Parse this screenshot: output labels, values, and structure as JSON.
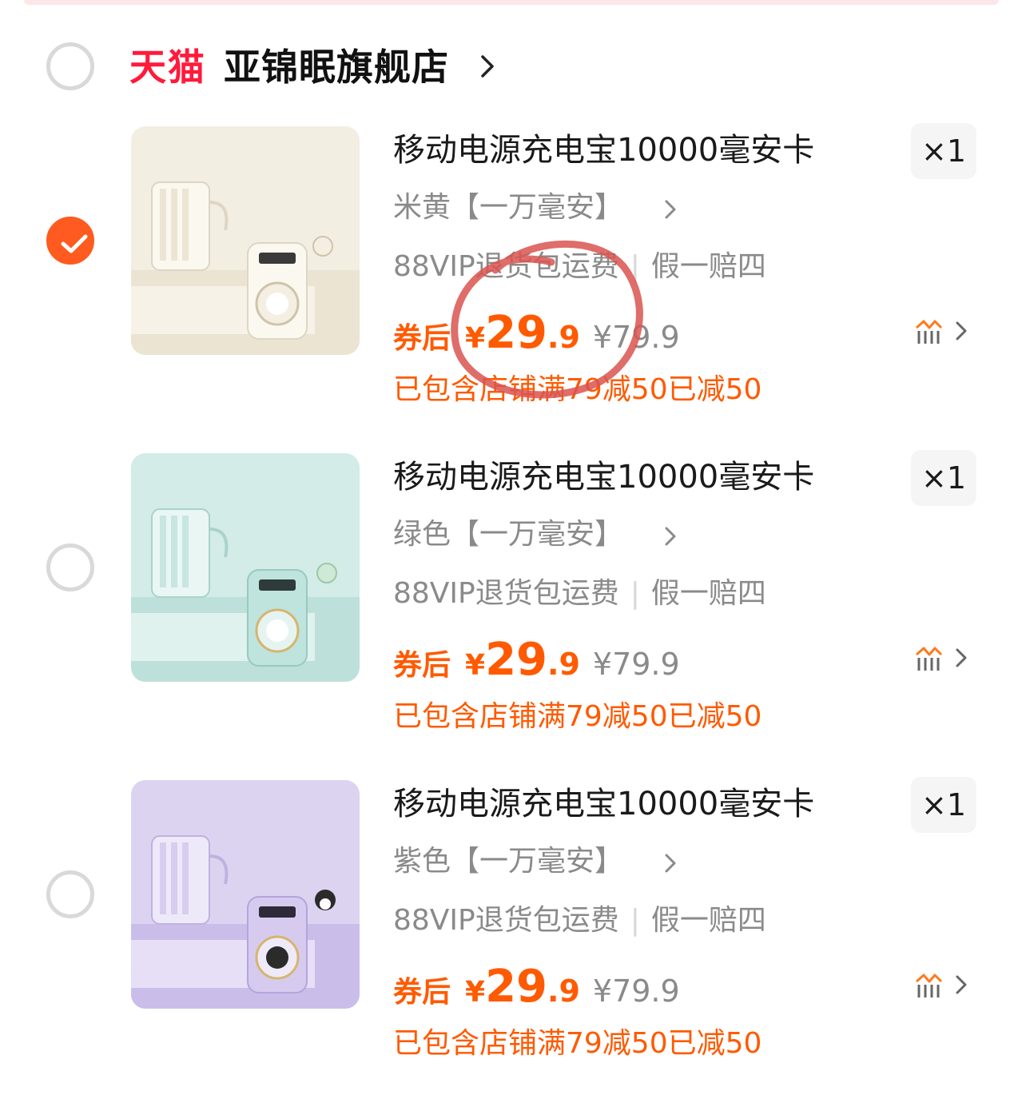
{
  "colors": {
    "accent": "#ff5a00",
    "tmall_red": "#ff1a3c",
    "checked": "#ff5a1f",
    "annotation": "#d9534f"
  },
  "shop": {
    "brand": "天猫",
    "name": "亚锦眠旗舰店",
    "checked": false
  },
  "items": [
    {
      "title": "移动电源充电宝10000毫安卡",
      "quantity": "×1",
      "sku": "米黄【一万毫安】",
      "service_1": "88VIP退货包运费",
      "service_2": "假一赔四",
      "coupon_label": "券后",
      "currency": "¥",
      "price_int": "29",
      "price_dec": ".9",
      "original_price": "¥79.9",
      "promo": "已包含店铺满79减50已减50",
      "checked": true,
      "thumb_bg": "#f1ece0",
      "thumb_accent": "cream"
    },
    {
      "title": "移动电源充电宝10000毫安卡",
      "quantity": "×1",
      "sku": "绿色【一万毫安】",
      "service_1": "88VIP退货包运费",
      "service_2": "假一赔四",
      "coupon_label": "券后",
      "currency": "¥",
      "price_int": "29",
      "price_dec": ".9",
      "original_price": "¥79.9",
      "promo": "已包含店铺满79减50已减50",
      "checked": false,
      "thumb_bg": "#cfe9e6",
      "thumb_accent": "mint"
    },
    {
      "title": "移动电源充电宝10000毫安卡",
      "quantity": "×1",
      "sku": "紫色【一万毫安】",
      "service_1": "88VIP退货包运费",
      "service_2": "假一赔四",
      "coupon_label": "券后",
      "currency": "¥",
      "price_int": "29",
      "price_dec": ".9",
      "original_price": "¥79.9",
      "promo": "已包含店铺满79减50已减50",
      "checked": false,
      "thumb_bg": "#d9d0ef",
      "thumb_accent": "lavender"
    }
  ],
  "icons": {
    "checkmark": "check-icon",
    "chevron": "chevron-right-icon",
    "similar": "find-similar-icon"
  }
}
